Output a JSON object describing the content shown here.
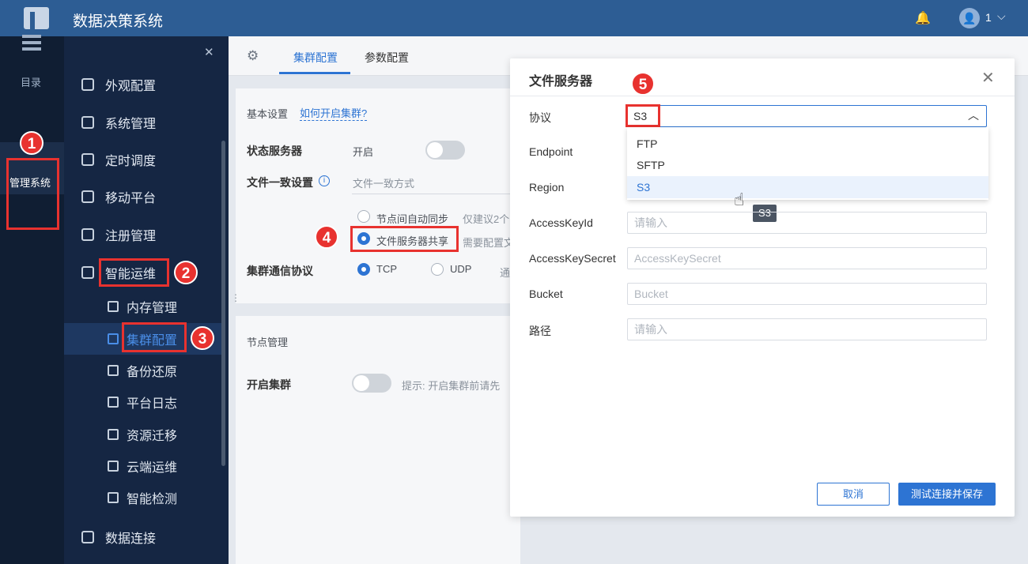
{
  "header": {
    "app_title": "数据决策系统",
    "user_name": "1"
  },
  "rail": {
    "directory_label": "目录",
    "admin_label": "管理系统"
  },
  "sidebar": {
    "items": [
      {
        "label": "外观配置",
        "icon": "paint-roller-icon"
      },
      {
        "label": "系统管理",
        "icon": "gear-icon"
      },
      {
        "label": "定时调度",
        "icon": "stopwatch-icon"
      },
      {
        "label": "移动平台",
        "icon": "mobile-icon"
      },
      {
        "label": "注册管理",
        "icon": "register-icon"
      },
      {
        "label": "智能运维",
        "icon": "nodes-icon"
      }
    ],
    "sub_items": [
      {
        "label": "内存管理",
        "icon": "memory-icon"
      },
      {
        "label": "集群配置",
        "icon": "cluster-icon"
      },
      {
        "label": "备份还原",
        "icon": "backup-icon"
      },
      {
        "label": "平台日志",
        "icon": "log-icon"
      },
      {
        "label": "资源迁移",
        "icon": "migrate-icon"
      },
      {
        "label": "云端运维",
        "icon": "cloud-icon"
      },
      {
        "label": "智能检测",
        "icon": "monitor-icon"
      }
    ],
    "bottom_item": {
      "label": "数据连接",
      "icon": "link-icon"
    }
  },
  "tabs": [
    {
      "label": "集群配置",
      "active": true
    },
    {
      "label": "参数配置",
      "active": false
    }
  ],
  "basic": {
    "section_title": "基本设置",
    "help_link": "如何开启集群?",
    "status_server_label": "状态服务器",
    "status_server_value": "开启",
    "file_consistency_label": "文件一致设置",
    "file_consistency_placeholder": "文件一致方式",
    "option_auto_sync": "节点间自动同步",
    "option_auto_sync_hint": "仅建议2个",
    "option_file_server": "文件服务器共享",
    "option_file_server_hint": "需要配置文",
    "protocol_label": "集群通信协议",
    "protocol_tcp": "TCP",
    "protocol_udp": "UDP",
    "protocol_hint": "通"
  },
  "nodes": {
    "section_title": "节点管理",
    "enable_label": "开启集群",
    "enable_hint": "提示: 开启集群前请先"
  },
  "dialog": {
    "title": "文件服务器",
    "protocol_label": "协议",
    "protocol_value": "S3",
    "options": [
      "FTP",
      "SFTP",
      "S3"
    ],
    "tooltip": "S3",
    "endpoint_label": "Endpoint",
    "region_label": "Region",
    "access_key_id_label": "AccessKeyId",
    "access_key_id_placeholder": "请输入",
    "access_key_secret_label": "AccessKeySecret",
    "access_key_secret_placeholder": "AccessKeySecret",
    "bucket_label": "Bucket",
    "bucket_placeholder": "Bucket",
    "path_label": "路径",
    "path_placeholder": "请输入",
    "cancel": "取消",
    "save": "测试连接并保存"
  },
  "annotations": [
    "1",
    "2",
    "3",
    "4",
    "5"
  ],
  "colors": {
    "accent": "#2d74d3",
    "highlight": "#e8322f",
    "topbar": "#2d5d94",
    "sidebar": "#152643"
  }
}
